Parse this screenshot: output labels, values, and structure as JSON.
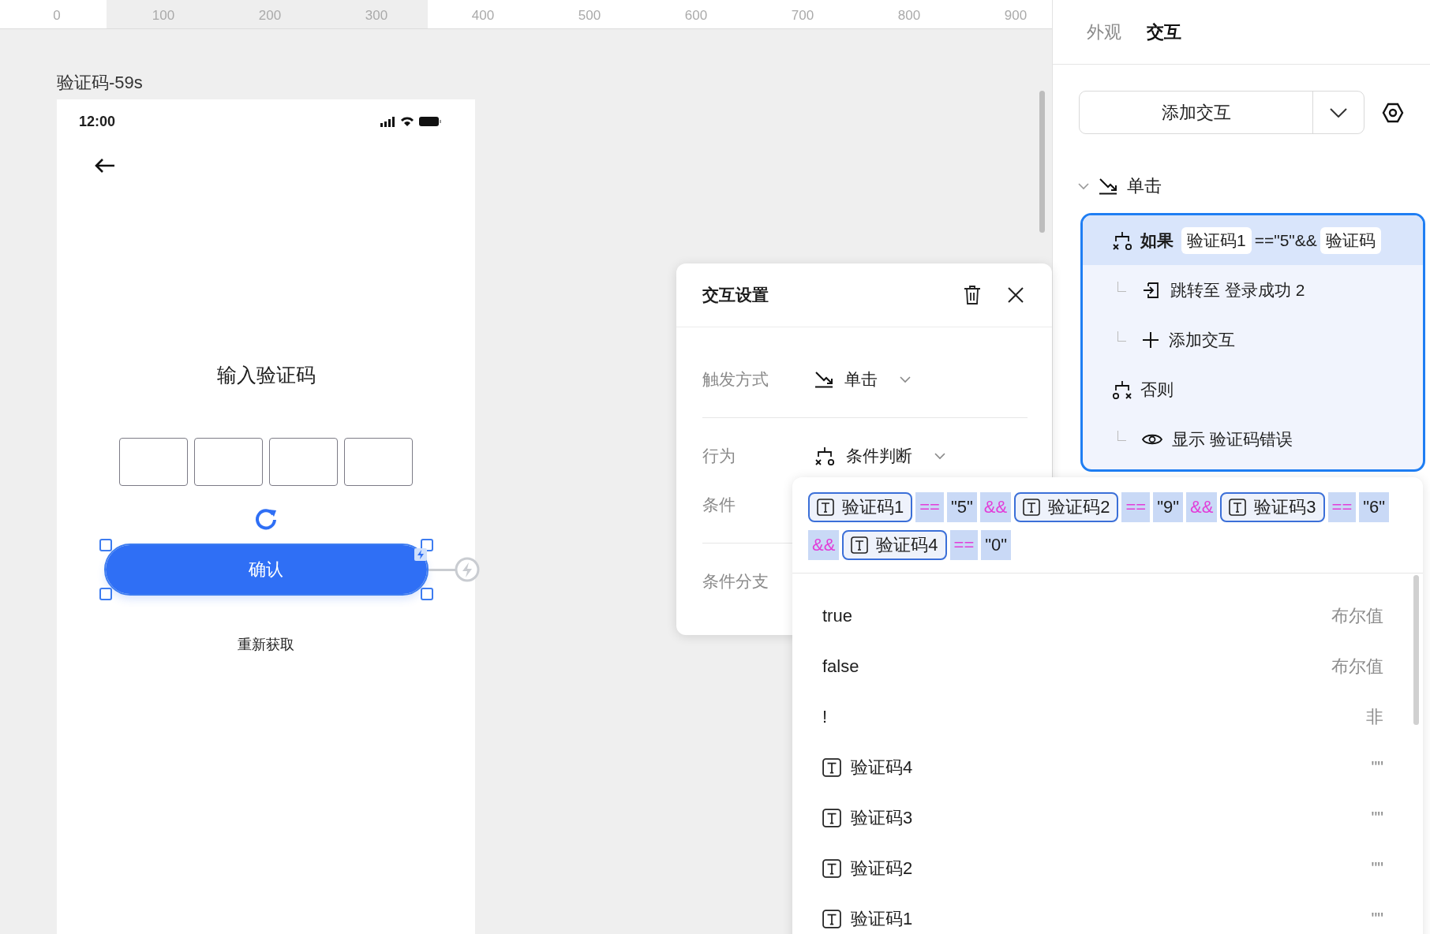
{
  "ruler": [
    "0",
    "100",
    "200",
    "300",
    "400",
    "500",
    "600",
    "700",
    "800",
    "900"
  ],
  "frame": {
    "label": "验证码-59s",
    "phone": {
      "time": "12:00",
      "title": "输入验证码",
      "code_inputs": [
        {
          "kind": "empty"
        },
        {
          "kind": "empty"
        },
        {
          "kind": "empty"
        },
        {
          "kind": "empty"
        }
      ],
      "confirm_button": {
        "label": "确认",
        "selected": true
      },
      "resend": "重新获取"
    }
  },
  "panel": {
    "tabs": [
      {
        "label": "外观",
        "selected": false
      },
      {
        "label": "交互",
        "selected": true
      }
    ],
    "add_button": "添加交互",
    "trigger": {
      "label": "单击",
      "expanded": true
    },
    "branches": [
      {
        "kind": "if",
        "label": "如果",
        "selected": true,
        "condition": [
          {
            "kind": "field",
            "text": "验证码1"
          },
          {
            "kind": "text",
            "text": "==\"5\"&&"
          },
          {
            "kind": "field",
            "text": "验证码"
          }
        ],
        "children": [
          {
            "kind": "goto",
            "label": "跳转至 登录成功 2"
          },
          {
            "kind": "add",
            "label": "添加交互"
          }
        ]
      },
      {
        "kind": "else",
        "label": "否则",
        "selected": false,
        "children": [
          {
            "kind": "show",
            "label": "显示 验证码错误"
          }
        ]
      }
    ]
  },
  "dialog": {
    "title": "交互设置",
    "rows": [
      {
        "kind": "trigger",
        "label": "触发方式",
        "value": "单击"
      },
      {
        "kind": "action",
        "label": "行为",
        "value": "条件判断"
      },
      {
        "kind": "condition",
        "label": "条件"
      },
      {
        "kind": "branches",
        "label": "条件分支"
      }
    ]
  },
  "dropdown": {
    "expression": [
      [
        {
          "kind": "field",
          "text": "验证码1"
        },
        {
          "kind": "op",
          "text": "=="
        },
        {
          "kind": "value",
          "text": "\"5\""
        },
        {
          "kind": "op",
          "text": "&&"
        },
        {
          "kind": "field",
          "text": "验证码2"
        },
        {
          "kind": "op",
          "text": "=="
        },
        {
          "kind": "value",
          "text": "\"9\""
        },
        {
          "kind": "op",
          "text": "&&"
        },
        {
          "kind": "field",
          "text": "验证码3"
        },
        {
          "kind": "op",
          "text": "=="
        },
        {
          "kind": "value",
          "text": "\"6\""
        }
      ],
      [
        {
          "kind": "op",
          "text": "&&"
        },
        {
          "kind": "field",
          "text": "验证码4"
        },
        {
          "kind": "op",
          "text": "=="
        },
        {
          "kind": "value",
          "text": "\"0\""
        }
      ]
    ],
    "options": [
      {
        "kind": "constant",
        "label": "true",
        "hint": "布尔值"
      },
      {
        "kind": "constant",
        "label": "false",
        "hint": "布尔值"
      },
      {
        "kind": "constant",
        "label": "!",
        "hint": "非"
      },
      {
        "kind": "field",
        "label": "验证码4",
        "hint": "\"\""
      },
      {
        "kind": "field",
        "label": "验证码3",
        "hint": "\"\""
      },
      {
        "kind": "field",
        "label": "验证码2",
        "hint": "\"\""
      },
      {
        "kind": "field",
        "label": "验证码1",
        "hint": "\"\""
      }
    ]
  }
}
